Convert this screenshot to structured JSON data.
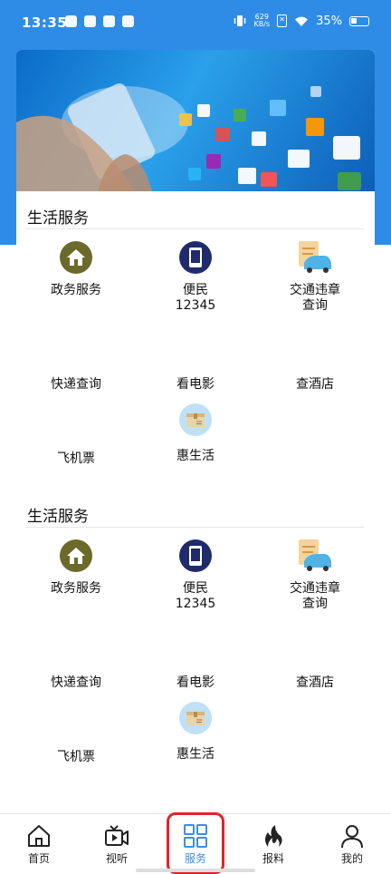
{
  "status_bar": {
    "time": "13:35",
    "net_speed_top": "629",
    "net_speed_bottom": "KB/s",
    "battery": "35%"
  },
  "sections": [
    {
      "title": "生活服务",
      "items": [
        {
          "label": "政务服务",
          "icon": "house-icon"
        },
        {
          "label": "便民\n12345",
          "icon": "phone-icon"
        },
        {
          "label": "交通违章\n查询",
          "icon": "car-icon"
        },
        {
          "label": "快递查询",
          "icon": ""
        },
        {
          "label": "看电影",
          "icon": ""
        },
        {
          "label": "查酒店",
          "icon": ""
        },
        {
          "label": "飞机票",
          "icon": ""
        },
        {
          "label": "惠生活",
          "icon": "package-icon"
        }
      ]
    },
    {
      "title": "生活服务",
      "items": [
        {
          "label": "政务服务",
          "icon": "house-icon"
        },
        {
          "label": "便民\n12345",
          "icon": "phone-icon"
        },
        {
          "label": "交通违章\n查询",
          "icon": "car-icon"
        },
        {
          "label": "快递查询",
          "icon": ""
        },
        {
          "label": "看电影",
          "icon": ""
        },
        {
          "label": "查酒店",
          "icon": ""
        },
        {
          "label": "飞机票",
          "icon": ""
        },
        {
          "label": "惠生活",
          "icon": "package-icon"
        }
      ]
    }
  ],
  "tab_bar": {
    "tabs": [
      {
        "label": "首页",
        "icon": "home-icon"
      },
      {
        "label": "视听",
        "icon": "video-icon"
      },
      {
        "label": "服务",
        "icon": "grid-icon"
      },
      {
        "label": "报料",
        "icon": "flame-icon"
      },
      {
        "label": "我的",
        "icon": "user-icon"
      }
    ],
    "active": "服务"
  },
  "colors": {
    "primary": "#2f8ce6",
    "active_tab": "#3a8fe0",
    "highlight": "#e0242b"
  }
}
